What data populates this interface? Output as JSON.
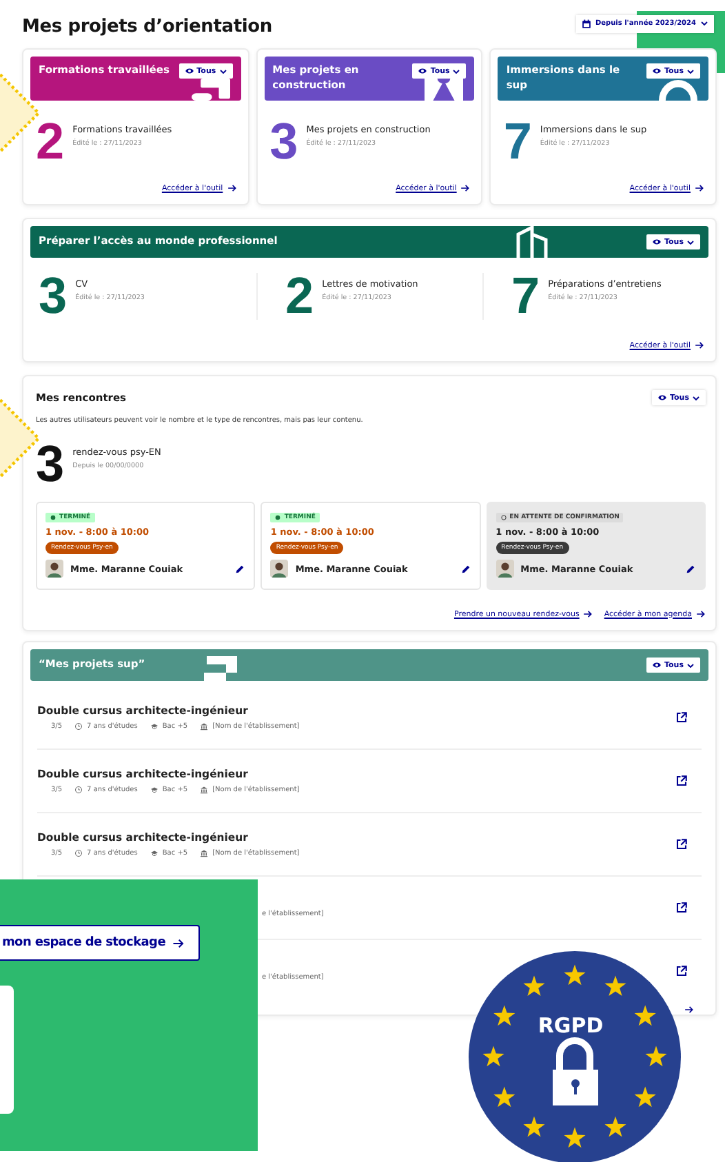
{
  "page": {
    "title": "Mes projets d’orientation",
    "period": "Depuis l'année 2023/2024"
  },
  "tool_cards": [
    {
      "title": "Formations travaillées",
      "color": "#b5157d",
      "visibility": "Tous",
      "count": "2",
      "label": "Formations travaillées",
      "edited": "Édité le : 27/11/2023",
      "link": "Accéder à l'outil"
    },
    {
      "title": "Mes projets en construction",
      "color": "#6a4cc4",
      "visibility": "Tous",
      "count": "3",
      "label": "Mes projets en construction",
      "edited": "Édité le : 27/11/2023",
      "link": "Accéder à l'outil"
    },
    {
      "title": "Immersions dans le sup",
      "color": "#1f7396",
      "visibility": "Tous",
      "count": "7",
      "label": "Immersions dans le sup",
      "edited": "Édité le : 27/11/2023",
      "link": "Accéder à l'outil"
    }
  ],
  "professional": {
    "title": "Préparer l’accès au monde professionnel",
    "visibility": "Tous",
    "link": "Accéder à l'outil",
    "stats": [
      {
        "count": "3",
        "label": "CV",
        "edited": "Édité le : 27/11/2023"
      },
      {
        "count": "2",
        "label": "Lettres de motivation",
        "edited": "Édité le : 27/11/2023"
      },
      {
        "count": "7",
        "label": "Préparations d’entretiens",
        "edited": "Édité le : 27/11/2023"
      }
    ]
  },
  "meetings": {
    "title": "Mes rencontres",
    "visibility": "Tous",
    "description": "Les autres utilisateurs peuvent voir le nombre et le type de rencontres, mais pas leur contenu.",
    "count": "3",
    "label": "rendez-vous psy-EN",
    "since": "Depuis le 00/00/0000",
    "appointments": [
      {
        "kind": "done",
        "status": "TERMINÉ",
        "time": "1 nov. - 8:00 à 10:00",
        "type": "Rendez-vous Psy-en",
        "person": "Mme. Maranne Couiak"
      },
      {
        "kind": "done",
        "status": "TERMINÉ",
        "time": "1 nov. - 8:00 à 10:00",
        "type": "Rendez-vous Psy-en",
        "person": "Mme. Maranne Couiak"
      },
      {
        "kind": "pending",
        "status": "EN ATTENTE DE CONFIRMATION",
        "time": "1 nov. - 8:00 à 10:00",
        "type": "Rendez-vous Psy-en",
        "person": "Mme. Maranne Couiak"
      }
    ],
    "links": [
      "Prendre un nouveau rendez-vous",
      "Accéder à mon agenda"
    ]
  },
  "projects": {
    "title": "“Mes projets sup”",
    "visibility": "Tous",
    "rows": [
      {
        "kind": "full",
        "title": "Double cursus architecte-ingénieur",
        "rating": "3/5",
        "duration": "7 ans d'études",
        "degree": "Bac +5",
        "school": "[Nom de l'établissement]"
      },
      {
        "kind": "full",
        "title": "Double cursus architecte-ingénieur",
        "rating": "3/5",
        "duration": "7 ans d'études",
        "degree": "Bac +5",
        "school": "[Nom de l'établissement]"
      },
      {
        "kind": "full",
        "title": "Double cursus architecte-ingénieur",
        "rating": "3/5",
        "duration": "7 ans d'études",
        "degree": "Bac +5",
        "school": "[Nom de l'établissement]"
      },
      {
        "kind": "partial",
        "school": "e l'établissement]"
      },
      {
        "kind": "partial",
        "school": "e l'établissement]"
      }
    ]
  },
  "storage_panel": {
    "button": "mon espace de stockage"
  },
  "badge": {
    "label": "RGPD"
  }
}
